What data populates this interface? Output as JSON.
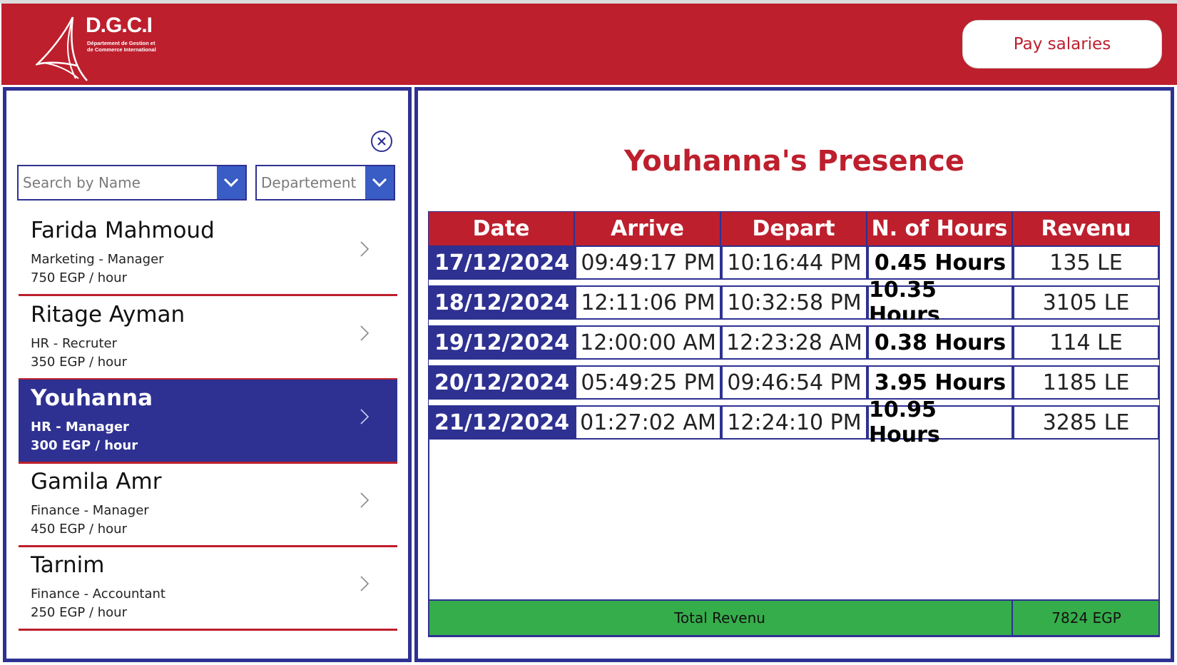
{
  "header": {
    "logo_title": "D.G.C.I",
    "logo_subtitle_line1": "Département de Gestion et",
    "logo_subtitle_line2": "de Commerce International",
    "pay_button_label": "Pay salaries",
    "header_color": "#bd1f2d"
  },
  "filters": {
    "search_placeholder": "Search by Name",
    "department_placeholder": "Departement"
  },
  "employees": [
    {
      "name": "Farida Mahmoud",
      "role": "Marketing - Manager",
      "rate": "750 EGP / hour",
      "selected": false
    },
    {
      "name": "Ritage Ayman",
      "role": "HR - Recruter",
      "rate": "350 EGP / hour",
      "selected": false
    },
    {
      "name": "Youhanna",
      "role": "HR - Manager",
      "rate": "300 EGP / hour",
      "selected": true
    },
    {
      "name": "Gamila Amr",
      "role": "Finance - Manager",
      "rate": "450 EGP / hour",
      "selected": false
    },
    {
      "name": "Tarnim",
      "role": "Finance - Accountant",
      "rate": "250 EGP / hour",
      "selected": false
    }
  ],
  "presence": {
    "title": "Youhanna's Presence",
    "columns": [
      "Date",
      "Arrive",
      "Depart",
      "N. of Hours",
      "Revenu"
    ],
    "rows": [
      {
        "date": "17/12/2024",
        "arrive": "09:49:17 PM",
        "depart": "10:16:44 PM",
        "hours": "0.45 Hours",
        "revenu": "135 LE"
      },
      {
        "date": "18/12/2024",
        "arrive": "12:11:06 PM",
        "depart": "10:32:58 PM",
        "hours": "10.35 Hours",
        "revenu": "3105 LE"
      },
      {
        "date": "19/12/2024",
        "arrive": "12:00:00 AM",
        "depart": "12:23:28 AM",
        "hours": "0.38 Hours",
        "revenu": "114 LE"
      },
      {
        "date": "20/12/2024",
        "arrive": "05:49:25 PM",
        "depart": "09:46:54 PM",
        "hours": "3.95 Hours",
        "revenu": "1185 LE"
      },
      {
        "date": "21/12/2024",
        "arrive": "01:27:02 AM",
        "depart": "12:24:10 PM",
        "hours": "10.95 Hours",
        "revenu": "3285 LE"
      }
    ],
    "total_label": "Total Revenu",
    "total_value": "7824 EGP"
  },
  "icons": {
    "clear": "close-circle-icon",
    "dropdown": "chevron-down-icon",
    "row": "chevron-right-icon"
  },
  "colors": {
    "brand_red": "#bd1f2d",
    "brand_blue": "#2e3192",
    "dropdown_blue": "#3a5cc5",
    "total_green": "#36ad4b"
  }
}
